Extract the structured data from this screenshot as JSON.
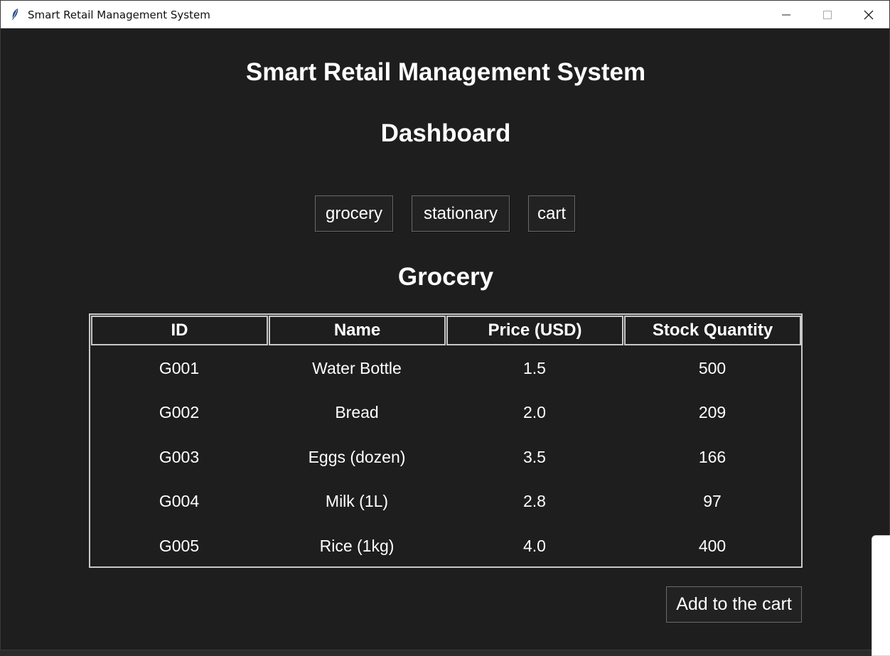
{
  "window": {
    "title": "Smart Retail Management System"
  },
  "app": {
    "title": "Smart Retail Management System",
    "subtitle": "Dashboard",
    "nav": [
      {
        "label": "grocery"
      },
      {
        "label": "stationary"
      },
      {
        "label": "cart"
      }
    ],
    "section_title": "Grocery",
    "add_button": "Add to the cart"
  },
  "table": {
    "columns": [
      "ID",
      "Name",
      "Price (USD)",
      "Stock Quantity"
    ],
    "rows": [
      [
        "G001",
        "Water Bottle",
        "1.5",
        "500"
      ],
      [
        "G002",
        "Bread",
        "2.0",
        "209"
      ],
      [
        "G003",
        "Eggs (dozen)",
        "3.5",
        "166"
      ],
      [
        "G004",
        "Milk (1L)",
        "2.8",
        "97"
      ],
      [
        "G005",
        "Rice (1kg)",
        "4.0",
        "400"
      ]
    ]
  },
  "colors": {
    "background": "#1e1e1e",
    "text": "#ffffff",
    "table_border": "#c8c8c8"
  }
}
